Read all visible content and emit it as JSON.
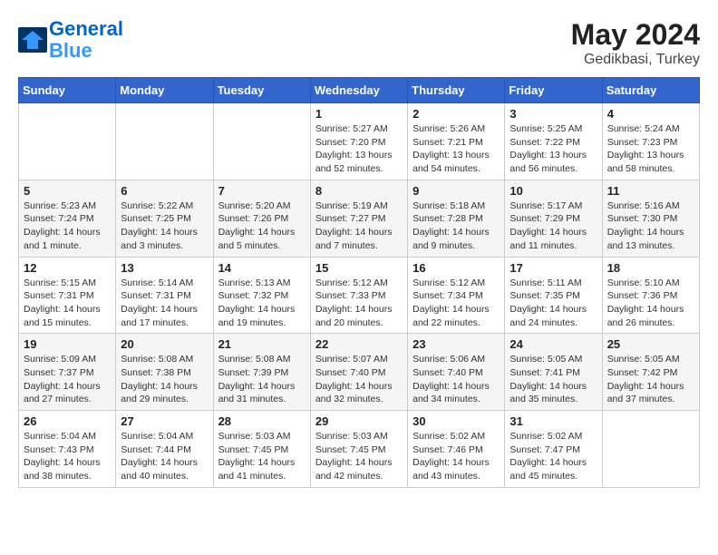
{
  "header": {
    "logo_line1": "General",
    "logo_line2": "Blue",
    "month": "May 2024",
    "location": "Gedikbasi, Turkey"
  },
  "weekdays": [
    "Sunday",
    "Monday",
    "Tuesday",
    "Wednesday",
    "Thursday",
    "Friday",
    "Saturday"
  ],
  "weeks": [
    [
      {
        "day": "",
        "info": ""
      },
      {
        "day": "",
        "info": ""
      },
      {
        "day": "",
        "info": ""
      },
      {
        "day": "1",
        "info": "Sunrise: 5:27 AM\nSunset: 7:20 PM\nDaylight: 13 hours\nand 52 minutes."
      },
      {
        "day": "2",
        "info": "Sunrise: 5:26 AM\nSunset: 7:21 PM\nDaylight: 13 hours\nand 54 minutes."
      },
      {
        "day": "3",
        "info": "Sunrise: 5:25 AM\nSunset: 7:22 PM\nDaylight: 13 hours\nand 56 minutes."
      },
      {
        "day": "4",
        "info": "Sunrise: 5:24 AM\nSunset: 7:23 PM\nDaylight: 13 hours\nand 58 minutes."
      }
    ],
    [
      {
        "day": "5",
        "info": "Sunrise: 5:23 AM\nSunset: 7:24 PM\nDaylight: 14 hours\nand 1 minute."
      },
      {
        "day": "6",
        "info": "Sunrise: 5:22 AM\nSunset: 7:25 PM\nDaylight: 14 hours\nand 3 minutes."
      },
      {
        "day": "7",
        "info": "Sunrise: 5:20 AM\nSunset: 7:26 PM\nDaylight: 14 hours\nand 5 minutes."
      },
      {
        "day": "8",
        "info": "Sunrise: 5:19 AM\nSunset: 7:27 PM\nDaylight: 14 hours\nand 7 minutes."
      },
      {
        "day": "9",
        "info": "Sunrise: 5:18 AM\nSunset: 7:28 PM\nDaylight: 14 hours\nand 9 minutes."
      },
      {
        "day": "10",
        "info": "Sunrise: 5:17 AM\nSunset: 7:29 PM\nDaylight: 14 hours\nand 11 minutes."
      },
      {
        "day": "11",
        "info": "Sunrise: 5:16 AM\nSunset: 7:30 PM\nDaylight: 14 hours\nand 13 minutes."
      }
    ],
    [
      {
        "day": "12",
        "info": "Sunrise: 5:15 AM\nSunset: 7:31 PM\nDaylight: 14 hours\nand 15 minutes."
      },
      {
        "day": "13",
        "info": "Sunrise: 5:14 AM\nSunset: 7:31 PM\nDaylight: 14 hours\nand 17 minutes."
      },
      {
        "day": "14",
        "info": "Sunrise: 5:13 AM\nSunset: 7:32 PM\nDaylight: 14 hours\nand 19 minutes."
      },
      {
        "day": "15",
        "info": "Sunrise: 5:12 AM\nSunset: 7:33 PM\nDaylight: 14 hours\nand 20 minutes."
      },
      {
        "day": "16",
        "info": "Sunrise: 5:12 AM\nSunset: 7:34 PM\nDaylight: 14 hours\nand 22 minutes."
      },
      {
        "day": "17",
        "info": "Sunrise: 5:11 AM\nSunset: 7:35 PM\nDaylight: 14 hours\nand 24 minutes."
      },
      {
        "day": "18",
        "info": "Sunrise: 5:10 AM\nSunset: 7:36 PM\nDaylight: 14 hours\nand 26 minutes."
      }
    ],
    [
      {
        "day": "19",
        "info": "Sunrise: 5:09 AM\nSunset: 7:37 PM\nDaylight: 14 hours\nand 27 minutes."
      },
      {
        "day": "20",
        "info": "Sunrise: 5:08 AM\nSunset: 7:38 PM\nDaylight: 14 hours\nand 29 minutes."
      },
      {
        "day": "21",
        "info": "Sunrise: 5:08 AM\nSunset: 7:39 PM\nDaylight: 14 hours\nand 31 minutes."
      },
      {
        "day": "22",
        "info": "Sunrise: 5:07 AM\nSunset: 7:40 PM\nDaylight: 14 hours\nand 32 minutes."
      },
      {
        "day": "23",
        "info": "Sunrise: 5:06 AM\nSunset: 7:40 PM\nDaylight: 14 hours\nand 34 minutes."
      },
      {
        "day": "24",
        "info": "Sunrise: 5:05 AM\nSunset: 7:41 PM\nDaylight: 14 hours\nand 35 minutes."
      },
      {
        "day": "25",
        "info": "Sunrise: 5:05 AM\nSunset: 7:42 PM\nDaylight: 14 hours\nand 37 minutes."
      }
    ],
    [
      {
        "day": "26",
        "info": "Sunrise: 5:04 AM\nSunset: 7:43 PM\nDaylight: 14 hours\nand 38 minutes."
      },
      {
        "day": "27",
        "info": "Sunrise: 5:04 AM\nSunset: 7:44 PM\nDaylight: 14 hours\nand 40 minutes."
      },
      {
        "day": "28",
        "info": "Sunrise: 5:03 AM\nSunset: 7:45 PM\nDaylight: 14 hours\nand 41 minutes."
      },
      {
        "day": "29",
        "info": "Sunrise: 5:03 AM\nSunset: 7:45 PM\nDaylight: 14 hours\nand 42 minutes."
      },
      {
        "day": "30",
        "info": "Sunrise: 5:02 AM\nSunset: 7:46 PM\nDaylight: 14 hours\nand 43 minutes."
      },
      {
        "day": "31",
        "info": "Sunrise: 5:02 AM\nSunset: 7:47 PM\nDaylight: 14 hours\nand 45 minutes."
      },
      {
        "day": "",
        "info": ""
      }
    ]
  ]
}
